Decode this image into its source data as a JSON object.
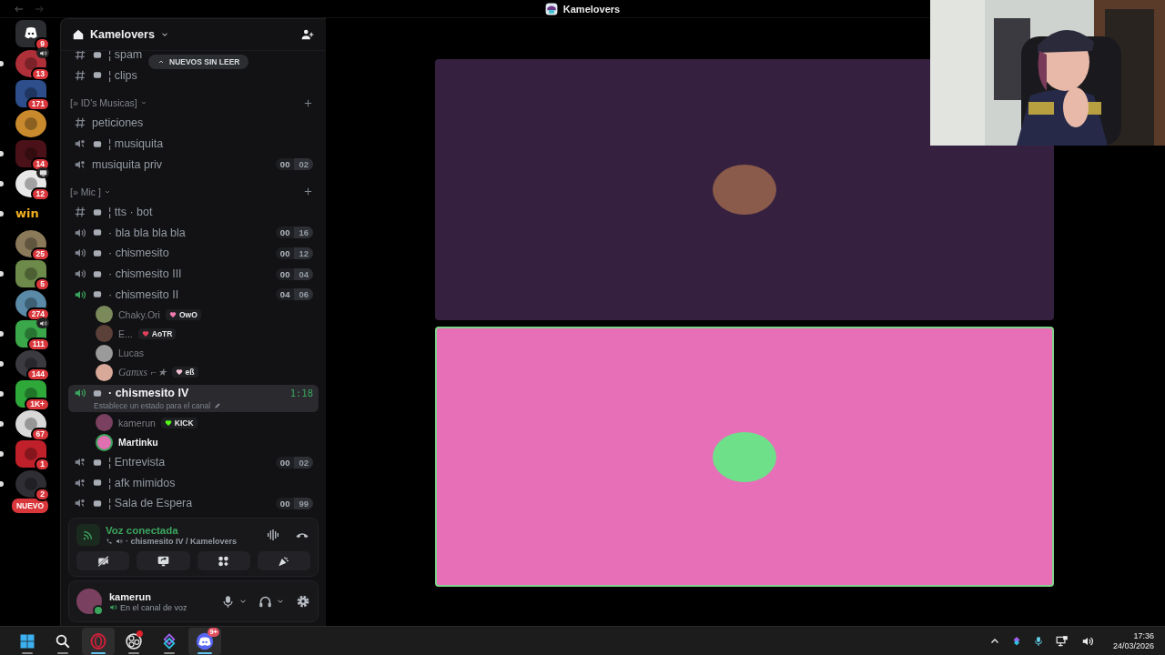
{
  "window": {
    "title": "Kamelovers"
  },
  "servers": [
    {
      "kind": "home",
      "badge": "9",
      "unread": false,
      "color": "#2b2d31"
    },
    {
      "kind": "server",
      "badge": "13",
      "unread": true,
      "voice": true,
      "color": "#b0303a"
    },
    {
      "kind": "server",
      "badge": "171",
      "unread": false,
      "color": "#2d4e8a"
    },
    {
      "kind": "server",
      "unread": false,
      "color": "#c98a2e"
    },
    {
      "kind": "server",
      "badge": "14",
      "unread": true,
      "color": "#4a1218"
    },
    {
      "kind": "server",
      "badge": "12",
      "unread": true,
      "streaming": true,
      "color": "#e8e8e8"
    },
    {
      "kind": "wordmark",
      "label": "win",
      "unread": true
    },
    {
      "kind": "server",
      "badge": "25",
      "unread": false,
      "color": "#8a7a5a"
    },
    {
      "kind": "server",
      "badge": "5",
      "unread": true,
      "color": "#6d8a4a"
    },
    {
      "kind": "server",
      "badge": "274",
      "unread": false,
      "color": "#5a8aa8"
    },
    {
      "kind": "server",
      "badge": "111",
      "unread": true,
      "voice": true,
      "color": "#3aa84a"
    },
    {
      "kind": "server",
      "badge": "144",
      "unread": true,
      "color": "#3a3a40"
    },
    {
      "kind": "server",
      "badge": "1K+",
      "unread": true,
      "color": "#2fa83a"
    },
    {
      "kind": "server",
      "badge": "67",
      "unread": true,
      "color": "#d8d8d8"
    },
    {
      "kind": "server",
      "badge": "1",
      "unread": true,
      "color": "#c0202a"
    },
    {
      "kind": "server",
      "badge": "2",
      "unread": true,
      "color": "#2e2e34"
    },
    {
      "kind": "new",
      "label": "NUEVO"
    }
  ],
  "channel_list": {
    "server_name": "Kamelovers",
    "unread_pill": "NUEVOS SIN LEER",
    "items": [
      {
        "kind": "text",
        "name": "¦ spam",
        "emoji": true,
        "selected": false
      },
      {
        "kind": "text",
        "name": "¦ clips",
        "emoji": true,
        "selected": false
      },
      {
        "kind": "category",
        "label": "[» ID's Musicas]"
      },
      {
        "kind": "text",
        "name": "peticiones",
        "emoji": false,
        "selected": false
      },
      {
        "kind": "stage",
        "name": "¦ musiquita",
        "emoji": true,
        "selected": false
      },
      {
        "kind": "stage",
        "name": "musiquita priv",
        "emoji": false,
        "selected": false,
        "counts": [
          "00",
          "02"
        ]
      },
      {
        "kind": "category",
        "label": "[» Mic ]"
      },
      {
        "kind": "text",
        "name": "¦ tts · bot",
        "emoji": true,
        "selected": false
      },
      {
        "kind": "voice",
        "name": "· bla bla bla bla",
        "emoji": true,
        "speaking": false,
        "selected": false,
        "counts": [
          "00",
          "16"
        ]
      },
      {
        "kind": "voice",
        "name": "· chismesito",
        "emoji": true,
        "speaking": false,
        "selected": false,
        "counts": [
          "00",
          "12"
        ]
      },
      {
        "kind": "voice",
        "name": "· chismesito III",
        "emoji": true,
        "speaking": false,
        "selected": false,
        "counts": [
          "00",
          "04"
        ]
      },
      {
        "kind": "voice",
        "name": "· chismesito II",
        "emoji": true,
        "speaking": true,
        "selected": false,
        "counts": [
          "04",
          "06"
        ],
        "users": [
          {
            "name": "Chaky.Ori",
            "speaking": false,
            "italic": false,
            "color": "#7a8a5a",
            "tag": {
              "text": "OwO",
              "color": "#f07ab0"
            }
          },
          {
            "name": "E...",
            "speaking": false,
            "italic": false,
            "color": "#5a4038",
            "tag": {
              "text": "AoTR",
              "color": "#e0405a"
            }
          },
          {
            "name": "Lucas",
            "speaking": false,
            "italic": false,
            "color": "#9a9a9a"
          },
          {
            "name": "Gamxs ⌐★",
            "speaking": false,
            "italic": true,
            "color": "#d8a898",
            "tag": {
              "text": "eß",
              "color": "#f0c0d0"
            }
          }
        ]
      },
      {
        "kind": "voice",
        "name": "· chismesito IV",
        "emoji": true,
        "speaking": true,
        "selected": true,
        "time": "1:18",
        "status": "Establece un estado para el canal",
        "users": [
          {
            "name": "kamerun",
            "speaking": false,
            "italic": false,
            "color": "#7a4060",
            "tag": {
              "text": "KICK",
              "color": "#53fc18"
            }
          },
          {
            "name": "Martinku",
            "speaking": true,
            "italic": false,
            "color": "#e070b0"
          }
        ]
      },
      {
        "kind": "stage",
        "name": "¦ Entrevista",
        "emoji": true,
        "selected": false,
        "counts": [
          "00",
          "02"
        ]
      },
      {
        "kind": "stage",
        "name": "¦ afk mimidos",
        "emoji": true,
        "selected": false
      },
      {
        "kind": "stage",
        "name": "¦ Sala de Espera",
        "emoji": true,
        "selected": false,
        "counts": [
          "00",
          "99"
        ]
      }
    ]
  },
  "voice_panel": {
    "title": "Voz conectada",
    "subtitle": "· chismesito IV / Kamelovers"
  },
  "user_panel": {
    "name": "kamerun",
    "status": "En el canal de voz"
  },
  "tiles": [
    {
      "color": "#35213f",
      "speaking": false,
      "avatar": {
        "color": "#8a5a4a"
      }
    },
    {
      "color": "#e66fb8",
      "speaking": true,
      "avatar": {
        "color": "#6ee08a"
      }
    }
  ],
  "taskbar": {
    "apps": [
      {
        "kind": "start",
        "active": false
      },
      {
        "kind": "search",
        "active": false
      },
      {
        "kind": "browser",
        "active": true
      },
      {
        "kind": "obs",
        "active": false,
        "alert": true
      },
      {
        "kind": "sync",
        "active": false
      },
      {
        "kind": "discord",
        "active": true,
        "badge": "9+"
      }
    ],
    "time": "17:36",
    "date": "24/03/2026"
  }
}
